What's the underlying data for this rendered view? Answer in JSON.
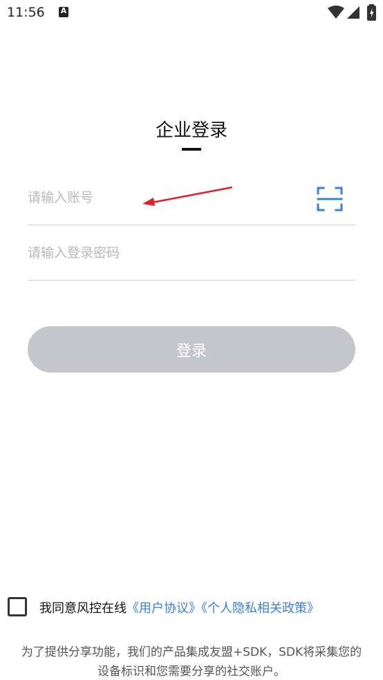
{
  "status_bar": {
    "time": "11:56",
    "notification_letter": "A"
  },
  "page": {
    "title": "企业登录"
  },
  "form": {
    "account_placeholder": "请输入账号",
    "account_value": "",
    "password_placeholder": "请输入登录密码",
    "password_value": "",
    "login_label": "登录",
    "scan_icon": "scan-qr-icon"
  },
  "agreement": {
    "checked": false,
    "prefix": "我同意风控在线",
    "user_agreement": "《用户协议》",
    "privacy_policy": "《个人隐私相关政策》"
  },
  "notice": {
    "line1": "为了提供分享功能，我们的产品集成友盟+SDK，SDK将采集您的",
    "line2": "设备标识和您需要分享的社交账户。"
  },
  "colors": {
    "accent": "#3b7fd8",
    "button_disabled": "#c4c6cc",
    "annotation_arrow": "#e02020"
  }
}
